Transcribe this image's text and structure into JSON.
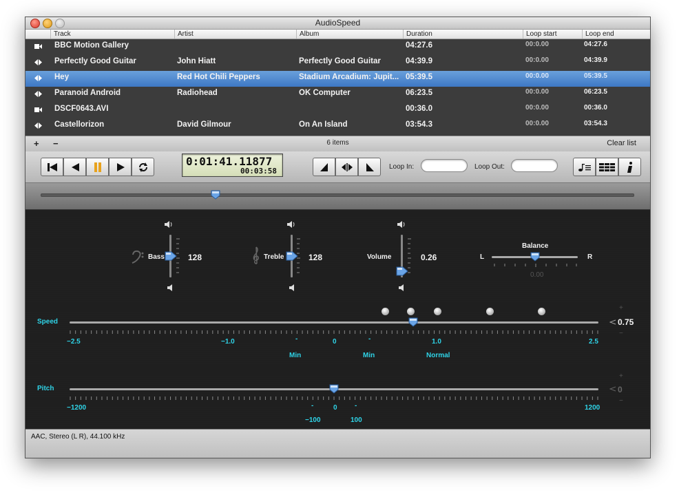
{
  "window": {
    "title": "AudioSpeed"
  },
  "columns": [
    "Track",
    "Artist",
    "Album",
    "Duration",
    "Loop start",
    "Loop end"
  ],
  "tracks": [
    {
      "type": "video-icon",
      "track": "BBC Motion Gallery",
      "artist": "",
      "album": "",
      "duration": "04:27.6",
      "loop_start": "00:0.00",
      "loop_end": "04:27.6"
    },
    {
      "type": "audio-icon",
      "track": "Perfectly Good Guitar",
      "artist": "John Hiatt",
      "album": "Perfectly Good Guitar",
      "duration": "04:39.9",
      "loop_start": "00:0.00",
      "loop_end": "04:39.9"
    },
    {
      "type": "audio-icon",
      "track": "Hey",
      "artist": "Red Hot Chili Peppers",
      "album": "Stadium Arcadium: Jupit...",
      "duration": "05:39.5",
      "loop_start": "00:0.00",
      "loop_end": "05:39.5",
      "selected": true
    },
    {
      "type": "audio-icon",
      "track": "Paranoid Android",
      "artist": "Radiohead",
      "album": "OK Computer",
      "duration": "06:23.5",
      "loop_start": "00:0.00",
      "loop_end": "06:23.5"
    },
    {
      "type": "video-icon",
      "track": "DSCF0643.AVI",
      "artist": "",
      "album": "",
      "duration": "00:36.0",
      "loop_start": "00:0.00",
      "loop_end": "00:36.0"
    },
    {
      "type": "audio-icon",
      "track": "Castellorizon",
      "artist": "David Gilmour",
      "album": "On An Island",
      "duration": "03:54.3",
      "loop_start": "00:0.00",
      "loop_end": "03:54.3"
    }
  ],
  "list_footer": {
    "add": "+",
    "remove": "−",
    "count": "6 items",
    "clear": "Clear list"
  },
  "transport": {
    "time": "0:01:41.11877",
    "total": "00:03:58",
    "loop_in_label": "Loop In:",
    "loop_out_label": "Loop Out:",
    "loop_in_value": "",
    "loop_out_value": ""
  },
  "playback_position": 0.295,
  "controls": {
    "bass": {
      "label": "Bass",
      "value": "128",
      "level": 0.5
    },
    "treble": {
      "label": "Treble",
      "value": "128",
      "level": 0.5
    },
    "volume": {
      "label": "Volume",
      "value": "0.26",
      "level": 0.26
    },
    "balance": {
      "label": "Balance",
      "left": "L",
      "right": "R",
      "value": "0.00",
      "level": 0.5
    },
    "speed": {
      "label": "Speed",
      "value": "0.75",
      "min": -2.5,
      "max": 2.5,
      "current": 0.75,
      "ticks": [
        "−2.5",
        "−1.0",
        "-",
        "0",
        "-",
        "1.0",
        "2.5"
      ],
      "markers": [
        "Min",
        "Min",
        "Normal"
      ]
    },
    "pitch": {
      "label": "Pitch",
      "value": "0",
      "min": -1200,
      "max": 1200,
      "current": 0,
      "ticks": [
        "−1200",
        "-",
        "0",
        "-",
        "1200"
      ],
      "sub_ticks": [
        "−100",
        "100"
      ]
    }
  },
  "status": {
    "format": "AAC, Stereo (L R), 44.100 kHz"
  },
  "colors": {
    "selection": "#3d78c5",
    "accent_cyan": "#2fd4e8",
    "list_bg": "#3c3c3c"
  }
}
